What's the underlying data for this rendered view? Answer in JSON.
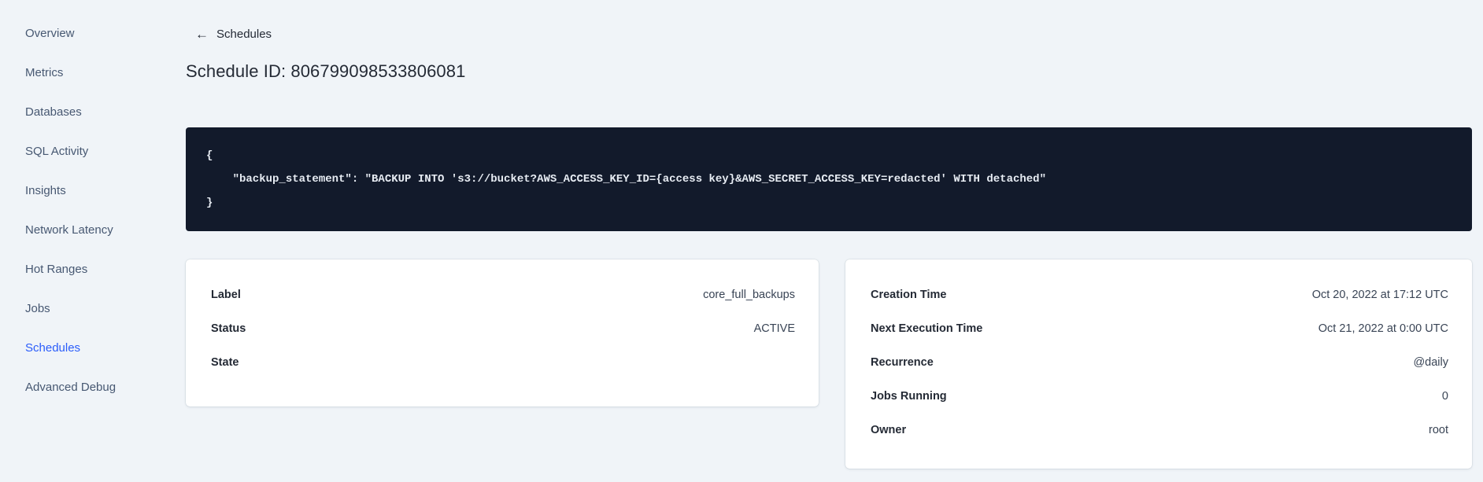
{
  "colors": {
    "accent": "#2b5dfa",
    "code_background": "#121a2b",
    "page_background": "#f0f4f8"
  },
  "sidebar": {
    "items": [
      {
        "label": "Overview"
      },
      {
        "label": "Metrics"
      },
      {
        "label": "Databases"
      },
      {
        "label": "SQL Activity"
      },
      {
        "label": "Insights"
      },
      {
        "label": "Network Latency"
      },
      {
        "label": "Hot Ranges"
      },
      {
        "label": "Jobs"
      },
      {
        "label": "Schedules",
        "active": true
      },
      {
        "label": "Advanced Debug"
      }
    ]
  },
  "header": {
    "back_icon": "←",
    "back_label": "Schedules",
    "title": "Schedule ID: 806799098533806081"
  },
  "code": {
    "content": "{\n    \"backup_statement\": \"BACKUP INTO 's3://bucket?AWS_ACCESS_KEY_ID={access key}&AWS_SECRET_ACCESS_KEY=redacted' WITH detached\"\n}"
  },
  "details_card": {
    "rows": [
      {
        "label": "Label",
        "value": "core_full_backups"
      },
      {
        "label": "Status",
        "value": "ACTIVE"
      },
      {
        "label": "State",
        "value": ""
      }
    ]
  },
  "timing_card": {
    "rows": [
      {
        "label": "Creation Time",
        "value": "Oct 20, 2022 at 17:12 UTC"
      },
      {
        "label": "Next Execution Time",
        "value": "Oct 21, 2022 at 0:00 UTC"
      },
      {
        "label": "Recurrence",
        "value": "@daily"
      },
      {
        "label": "Jobs Running",
        "value": "0"
      },
      {
        "label": "Owner",
        "value": "root"
      }
    ]
  }
}
